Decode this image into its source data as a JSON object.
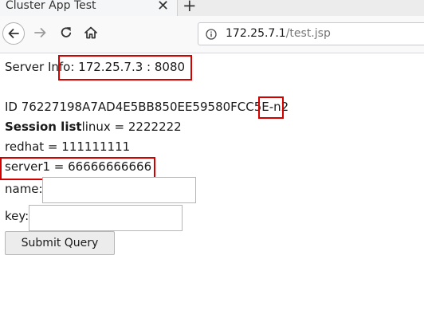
{
  "browser": {
    "tab_title": "Cluster App Test",
    "close_glyph": "✕",
    "new_tab_glyph": "+",
    "url_host": "172.25.7.1",
    "url_path": "/test.jsp"
  },
  "page": {
    "server_info": "Server Info: 172.25.7.3 : 8080",
    "session_id": "ID 76227198A7AD4E5BB850EE59580FCC5E-n2",
    "session_list_label": "Session list",
    "session_items": [
      "linux = 2222222",
      "redhat = 111111111",
      "server1 = 66666666666"
    ],
    "name_label": "name:",
    "name_value": "",
    "key_label": "key:",
    "key_value": "",
    "submit_label": "Submit Query"
  },
  "colors": {
    "highlight_box": "#d40000"
  },
  "icons": {
    "back": "arrow-left-icon",
    "forward": "arrow-right-icon",
    "reload": "reload-icon",
    "home": "home-icon",
    "site_info": "info-icon"
  }
}
